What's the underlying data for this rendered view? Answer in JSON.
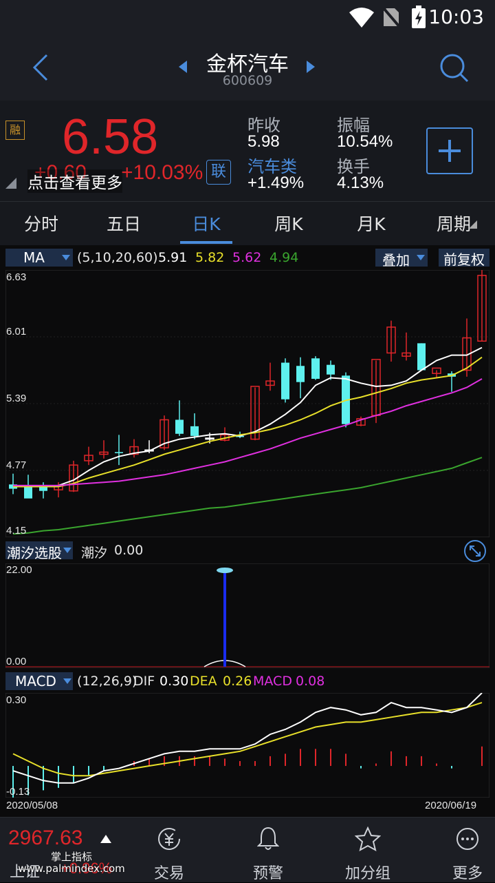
{
  "status": {
    "time": "10:03"
  },
  "header": {
    "title": "金杯汽车",
    "code": "600609"
  },
  "quote": {
    "price": "6.58",
    "change": "+0.60",
    "change_pct": "+10.03%",
    "rong_badge": "融",
    "lian_badge": "联",
    "tip": "点击查看更多",
    "prev_close_label": "昨收",
    "prev_close": "5.98",
    "amplitude_label": "振幅",
    "amplitude": "10.54%",
    "sector_label": "汽车类",
    "sector_change": "+1.49%",
    "turnover_label": "换手",
    "turnover": "4.13%"
  },
  "tabs": [
    "分时",
    "五日",
    "日K",
    "周K",
    "月K",
    "周期"
  ],
  "active_tab": "日K",
  "ma_bar": {
    "selector": "MA",
    "params": "(5,10,20,60)",
    "ma5": "5.91",
    "ma10": "5.82",
    "ma20": "5.62",
    "ma60": "4.94",
    "overlay_label": "叠加",
    "adjust_label": "前复权"
  },
  "price_axis": [
    "6.63",
    "6.01",
    "5.39",
    "4.77",
    "4.15"
  ],
  "indicator2": {
    "selector": "潮汐选股",
    "name": "潮汐",
    "value": "0.00",
    "top": "22.00",
    "bottom": "0.00"
  },
  "macd_bar": {
    "selector": "MACD",
    "params": "(12,26,9)",
    "dif_label": "DIF",
    "dif": "0.30",
    "dea_label": "DEA",
    "dea": "0.26",
    "macd_label": "MACD",
    "macd": "0.08"
  },
  "macd_axis": {
    "top": "0.30",
    "bottom": "-0.13"
  },
  "dates": {
    "start": "2020/05/08",
    "end": "2020/06/19"
  },
  "bottom_nav": {
    "index_value": "2967.63",
    "index_label": "上证",
    "index_change": "+0.96%",
    "items": [
      "交易",
      "预警",
      "加分组",
      "更多"
    ]
  },
  "watermark": "掌上指标 www.palmindex.com",
  "colors": {
    "up": "#e0262a",
    "down": "#5ef0ee",
    "ma5": "#ffffff",
    "ma10": "#e8e02a",
    "ma20": "#e030e0",
    "ma60": "#3aa52e",
    "accent": "#4a8cdc"
  },
  "chart_data": [
    {
      "type": "candlestick",
      "title": "",
      "xlabel": "",
      "ylabel": "",
      "x_range": [
        "2020/05/08",
        "2020/06/19"
      ],
      "ylim": [
        4.15,
        6.63
      ],
      "y_ticks": [
        6.63,
        6.01,
        5.39,
        4.77,
        4.15
      ],
      "ohlc": [
        [
          4.64,
          4.74,
          4.55,
          4.6
        ],
        [
          4.63,
          4.73,
          4.53,
          4.51
        ],
        [
          4.62,
          4.66,
          4.51,
          4.58
        ],
        [
          4.59,
          4.66,
          4.52,
          4.63
        ],
        [
          4.58,
          4.86,
          4.57,
          4.82
        ],
        [
          4.86,
          4.99,
          4.82,
          4.91
        ],
        [
          4.92,
          5.05,
          4.88,
          4.94
        ],
        [
          4.94,
          5.1,
          4.82,
          4.93
        ],
        [
          4.92,
          5.06,
          4.89,
          4.99
        ],
        [
          4.96,
          5.05,
          4.93,
          4.96
        ],
        [
          4.98,
          5.28,
          4.96,
          5.24
        ],
        [
          5.24,
          5.42,
          5.09,
          5.11
        ],
        [
          5.18,
          5.3,
          5.06,
          5.09
        ],
        [
          5.07,
          5.12,
          5.02,
          5.07
        ],
        [
          5.05,
          5.17,
          5.04,
          5.1
        ],
        [
          5.09,
          5.13,
          5.07,
          5.08
        ],
        [
          5.06,
          5.54,
          5.05,
          5.55
        ],
        [
          5.56,
          5.77,
          5.51,
          5.6
        ],
        [
          5.77,
          5.81,
          5.4,
          5.43
        ],
        [
          5.74,
          5.82,
          5.44,
          5.59
        ],
        [
          5.81,
          5.83,
          5.61,
          5.62
        ],
        [
          5.75,
          5.79,
          5.61,
          5.66
        ],
        [
          5.65,
          5.68,
          5.17,
          5.2
        ],
        [
          5.19,
          5.27,
          5.18,
          5.25
        ],
        [
          5.28,
          5.79,
          5.21,
          5.8
        ],
        [
          5.86,
          6.16,
          5.78,
          6.1
        ],
        [
          5.83,
          6.05,
          5.79,
          5.86
        ],
        [
          5.95,
          5.95,
          5.7,
          5.7
        ],
        [
          5.67,
          5.7,
          5.63,
          5.72
        ],
        [
          5.67,
          5.69,
          5.5,
          5.64
        ],
        [
          5.7,
          6.18,
          5.64,
          6.0
        ],
        [
          5.97,
          6.63,
          5.97,
          6.58
        ]
      ],
      "series": [
        {
          "name": "MA5",
          "values": [
            4.63,
            4.62,
            4.62,
            4.63,
            4.68,
            4.77,
            4.85,
            4.9,
            4.93,
            4.95,
            5.02,
            5.06,
            5.08,
            5.1,
            5.11,
            5.09,
            5.13,
            5.2,
            5.29,
            5.4,
            5.56,
            5.63,
            5.62,
            5.58,
            5.55,
            5.56,
            5.6,
            5.7,
            5.79,
            5.84,
            5.84,
            5.91
          ]
        },
        {
          "name": "MA10",
          "values": [
            4.62,
            4.62,
            4.62,
            4.62,
            4.65,
            4.7,
            4.74,
            4.78,
            4.82,
            4.87,
            4.92,
            4.96,
            5.0,
            5.04,
            5.07,
            5.1,
            5.12,
            5.15,
            5.19,
            5.24,
            5.3,
            5.37,
            5.42,
            5.45,
            5.49,
            5.53,
            5.58,
            5.61,
            5.63,
            5.65,
            5.72,
            5.82
          ]
        },
        {
          "name": "MA20",
          "values": [
            4.63,
            4.63,
            4.63,
            4.63,
            4.64,
            4.65,
            4.66,
            4.67,
            4.69,
            4.71,
            4.73,
            4.76,
            4.79,
            4.82,
            4.85,
            4.89,
            4.93,
            4.97,
            5.02,
            5.07,
            5.11,
            5.15,
            5.19,
            5.24,
            5.28,
            5.32,
            5.37,
            5.41,
            5.45,
            5.49,
            5.54,
            5.62
          ]
        },
        {
          "name": "MA60",
          "values": [
            4.18,
            4.19,
            4.21,
            4.22,
            4.24,
            4.26,
            4.28,
            4.3,
            4.32,
            4.34,
            4.36,
            4.38,
            4.4,
            4.42,
            4.43,
            4.45,
            4.47,
            4.49,
            4.51,
            4.53,
            4.55,
            4.57,
            4.59,
            4.61,
            4.64,
            4.67,
            4.7,
            4.73,
            4.76,
            4.79,
            4.84,
            4.89
          ]
        }
      ]
    },
    {
      "type": "bar",
      "title": "",
      "xlabel": "",
      "ylabel": "",
      "ylim": [
        0,
        22
      ],
      "series": [
        {
          "name": "潮汐",
          "values": [
            0,
            0,
            0,
            0,
            0,
            0,
            0,
            0,
            0,
            0,
            0,
            0,
            0,
            0,
            22,
            0,
            0,
            0,
            0,
            0,
            0,
            0,
            0,
            0,
            0,
            0,
            0,
            0,
            0,
            0,
            0,
            0
          ]
        }
      ]
    },
    {
      "type": "bar",
      "title": "",
      "xlabel": "",
      "ylabel": "",
      "ylim": [
        -0.13,
        0.3
      ],
      "series": [
        {
          "name": "DIF",
          "values": [
            -0.02,
            -0.04,
            -0.06,
            -0.07,
            -0.07,
            -0.05,
            -0.02,
            -0.01,
            0.01,
            0.03,
            0.05,
            0.06,
            0.06,
            0.07,
            0.07,
            0.07,
            0.09,
            0.13,
            0.15,
            0.18,
            0.22,
            0.24,
            0.23,
            0.21,
            0.22,
            0.26,
            0.24,
            0.24,
            0.23,
            0.22,
            0.24,
            0.3
          ]
        },
        {
          "name": "DEA",
          "values": [
            0.05,
            0.02,
            -0.01,
            -0.03,
            -0.04,
            -0.04,
            -0.03,
            -0.02,
            -0.01,
            0.0,
            0.01,
            0.02,
            0.03,
            0.04,
            0.05,
            0.06,
            0.08,
            0.1,
            0.12,
            0.14,
            0.16,
            0.17,
            0.18,
            0.18,
            0.19,
            0.2,
            0.21,
            0.22,
            0.22,
            0.23,
            0.24,
            0.26
          ]
        },
        {
          "name": "MACD",
          "values": [
            -0.14,
            -0.12,
            -0.1,
            -0.09,
            -0.07,
            -0.04,
            -0.02,
            0.0,
            0.02,
            0.03,
            0.04,
            0.04,
            0.04,
            0.04,
            0.03,
            0.02,
            0.02,
            0.04,
            0.05,
            0.07,
            0.07,
            0.07,
            0.05,
            -0.01,
            0.01,
            0.06,
            0.04,
            0.04,
            0.01,
            -0.01,
            0.0,
            0.08
          ]
        }
      ]
    }
  ]
}
